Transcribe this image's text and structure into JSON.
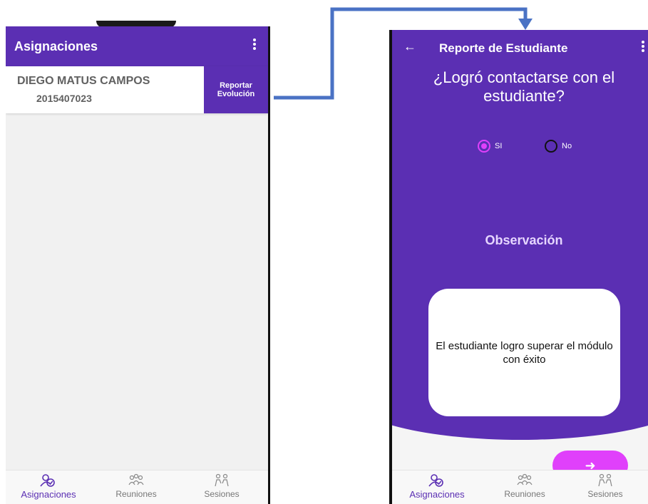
{
  "left_screen": {
    "title": "Asignaciones",
    "student": {
      "name": "DIEGO MATUS CAMPOS",
      "code": "2015407023",
      "report_button": [
        "Reportar",
        "Evolución"
      ]
    },
    "nav": [
      {
        "label": "Asignaciones",
        "icon": "people-check-icon",
        "active": true
      },
      {
        "label": "Reuniones",
        "icon": "group-icon",
        "active": false
      },
      {
        "label": "Sesiones",
        "icon": "session-icon",
        "active": false
      }
    ]
  },
  "right_screen": {
    "title": "Reporte de Estudiante",
    "back_icon": "arrow-left-icon",
    "question": "¿Logró contactarse con el estudiante?",
    "options": [
      {
        "label": "SI",
        "selected": true
      },
      {
        "label": "No",
        "selected": false
      }
    ],
    "observation_label": "Observación",
    "observation_text": "El estudiante logro superar el módulo con éxito",
    "next_icon": "arrow-right-icon",
    "nav": [
      {
        "label": "Asignaciones",
        "icon": "people-check-icon",
        "active": true
      },
      {
        "label": "Reuniones",
        "icon": "group-icon",
        "active": false
      },
      {
        "label": "Sesiones",
        "icon": "session-icon",
        "active": false
      }
    ]
  },
  "colors": {
    "primary": "#5b2fb3",
    "accent": "#e040fb",
    "connector": "#4a72c4"
  }
}
